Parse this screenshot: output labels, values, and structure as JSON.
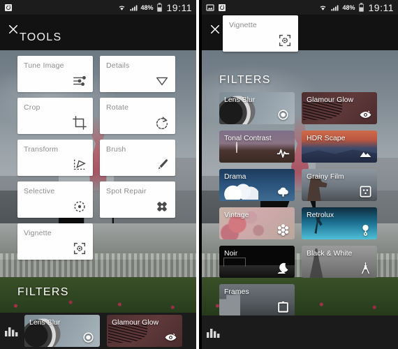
{
  "statusbar": {
    "battery": "48%",
    "time": "19:11",
    "icons_left": [
      "photo-sync-icon"
    ],
    "icons_left_right_panel": [
      "image-icon",
      "photo-sync-icon"
    ],
    "icons_right": [
      "wifi-icon",
      "signal-icon",
      "battery-icon"
    ]
  },
  "left_panel": {
    "close_label": "✕",
    "title": "TOOLS",
    "tools": [
      {
        "label": "Tune Image",
        "icon": "sliders-icon"
      },
      {
        "label": "Details",
        "icon": "triangle-down-icon"
      },
      {
        "label": "Crop",
        "icon": "crop-icon"
      },
      {
        "label": "Rotate",
        "icon": "rotate-icon"
      },
      {
        "label": "Transform",
        "icon": "transform-icon"
      },
      {
        "label": "Brush",
        "icon": "brush-icon"
      },
      {
        "label": "Selective",
        "icon": "selective-icon"
      },
      {
        "label": "Spot Repair",
        "icon": "spot-repair-icon"
      },
      {
        "label": "Vignette",
        "icon": "vignette-icon"
      }
    ],
    "filters_title": "FILTERS",
    "bottom_filters": [
      {
        "label": "Lens Blur",
        "icon": "aperture-icon",
        "thumb": "th-lensblur"
      },
      {
        "label": "Glamour Glow",
        "icon": "eye-icon",
        "thumb": "th-glamour"
      }
    ],
    "histogram_icon": "histogram-icon"
  },
  "right_panel": {
    "close_label": "✕",
    "scrolled_card": {
      "label": "Vignette",
      "icon": "vignette-icon"
    },
    "filters_title": "FILTERS",
    "filters": [
      {
        "label": "Lens Blur",
        "icon": "aperture-icon",
        "thumb": "th-lensblur"
      },
      {
        "label": "Glamour Glow",
        "icon": "eye-icon",
        "thumb": "th-glamour"
      },
      {
        "label": "Tonal Contrast",
        "icon": "waveform-icon",
        "thumb": "th-tonal"
      },
      {
        "label": "HDR Scape",
        "icon": "mountains-icon",
        "thumb": "th-hdr"
      },
      {
        "label": "Drama",
        "icon": "cloud-icon",
        "thumb": "th-drama"
      },
      {
        "label": "Grainy Film",
        "icon": "grain-icon",
        "thumb": "th-grainy"
      },
      {
        "label": "Vintage",
        "icon": "flower-icon",
        "thumb": "th-vintage"
      },
      {
        "label": "Retrolux",
        "icon": "lamp-icon",
        "thumb": "th-retro"
      },
      {
        "label": "Noir",
        "icon": "moon-icon",
        "thumb": "th-noir"
      },
      {
        "label": "Black & White",
        "icon": "eiffel-icon",
        "thumb": "th-bw"
      },
      {
        "label": "Frames",
        "icon": "frame-icon",
        "thumb": "th-frames"
      }
    ],
    "histogram_icon": "histogram-icon"
  },
  "colors": {
    "statusbar_bg": "#1c1c1c",
    "header_bg": "#121212",
    "bar_bg": "#1b1b1b",
    "card_bg": "#fefefe",
    "label_gray": "#8d8d8d"
  }
}
